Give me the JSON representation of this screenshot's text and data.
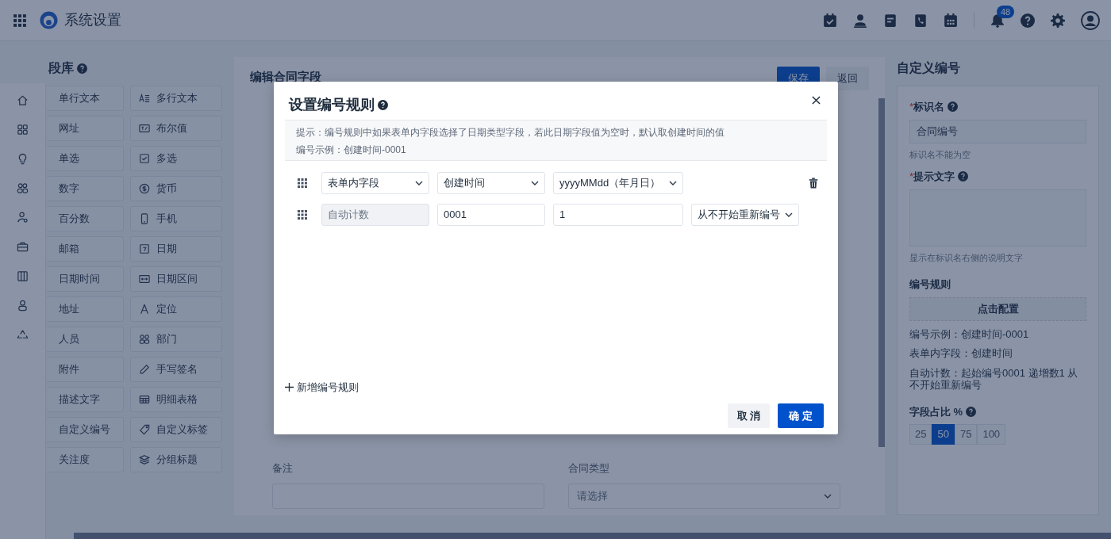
{
  "header": {
    "title": "系统设置",
    "notification_count": "48"
  },
  "field_library": {
    "title": "段库",
    "items": [
      {
        "label": "单行文本"
      },
      {
        "label": "多行文本"
      },
      {
        "label": "网址"
      },
      {
        "label": "布尔值"
      },
      {
        "label": "单选"
      },
      {
        "label": "多选"
      },
      {
        "label": "数字"
      },
      {
        "label": "货币"
      },
      {
        "label": "百分数"
      },
      {
        "label": "手机"
      },
      {
        "label": "邮箱"
      },
      {
        "label": "日期"
      },
      {
        "label": "日期时间"
      },
      {
        "label": "日期区间"
      },
      {
        "label": "地址"
      },
      {
        "label": "定位"
      },
      {
        "label": "人员"
      },
      {
        "label": "部门"
      },
      {
        "label": "附件"
      },
      {
        "label": "手写签名"
      },
      {
        "label": "描述文字"
      },
      {
        "label": "明细表格"
      },
      {
        "label": "自定义编号"
      },
      {
        "label": "自定义标签"
      },
      {
        "label": "关注度"
      },
      {
        "label": "分组标题"
      }
    ]
  },
  "editor": {
    "title": "编辑合同字段",
    "buttons": [
      {
        "label": "保存",
        "kind": "primary"
      },
      {
        "label": "返回",
        "kind": "secondary"
      }
    ],
    "fields": [
      {
        "label": "备注",
        "kind": "input"
      },
      {
        "label": "合同类型",
        "kind": "select",
        "placeholder": "请选择"
      }
    ]
  },
  "properties": {
    "title": "自定义编号",
    "fields": [
      {
        "marker": "*",
        "label": "标识名",
        "kind": "input",
        "value": "合同编号",
        "help": "标识名不能为空"
      },
      {
        "marker": "*",
        "label": "提示文字",
        "kind": "textarea",
        "help": "显示在标识名右侧的说明文字"
      }
    ],
    "rule": {
      "label": "编号规则",
      "button": "点击配置",
      "lines": [
        "编号示例：创建时间-0001",
        "表单内字段：创建时间",
        "自动计数：起始编号0001 递增数1 从不开始重新编号"
      ]
    },
    "ratio": {
      "label": "字段占比 %",
      "options": [
        {
          "label": "25",
          "selected": false
        },
        {
          "label": "50",
          "selected": true
        },
        {
          "label": "75",
          "selected": false
        },
        {
          "label": "100",
          "selected": false
        }
      ]
    }
  },
  "modal": {
    "title": "设置编号规则",
    "hints": [
      "提示：编号规则中如果表单内字段选择了日期类型字段，若此日期字段值为空时，默认取创建时间的值",
      "编号示例：创建时间-0001"
    ],
    "rows": [
      {
        "deletable": true,
        "parts": [
          {
            "kind": "select",
            "value": "表单内字段"
          },
          {
            "kind": "select",
            "value": "创建时间"
          },
          {
            "kind": "select",
            "value": "yyyyMMdd（年月日）"
          }
        ]
      },
      {
        "deletable": false,
        "parts": [
          {
            "kind": "disabled",
            "value": "自动计数"
          },
          {
            "kind": "input",
            "value": "0001"
          },
          {
            "kind": "input",
            "value": "1"
          },
          {
            "kind": "select",
            "value": "从不开始重新编号"
          }
        ]
      }
    ],
    "add_link": "新增编号规则",
    "buttons": [
      {
        "label": "取 消",
        "kind": "secondary"
      },
      {
        "label": "确 定",
        "kind": "primary"
      }
    ]
  }
}
